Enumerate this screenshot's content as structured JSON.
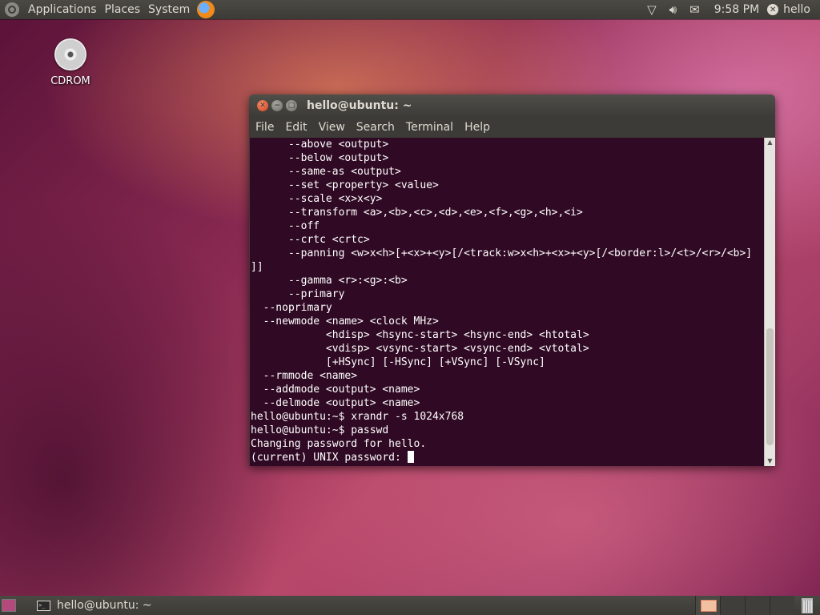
{
  "top_panel": {
    "menus": [
      "Applications",
      "Places",
      "System"
    ],
    "clock": "9:58 PM",
    "user": "hello"
  },
  "desktop": {
    "icons": [
      {
        "label": "CDROM",
        "icon": "cdrom-icon"
      }
    ]
  },
  "terminal_window": {
    "title": "hello@ubuntu: ~",
    "menus": [
      "File",
      "Edit",
      "View",
      "Search",
      "Terminal",
      "Help"
    ],
    "lines": [
      "      --above <output>",
      "      --below <output>",
      "      --same-as <output>",
      "      --set <property> <value>",
      "      --scale <x>x<y>",
      "      --transform <a>,<b>,<c>,<d>,<e>,<f>,<g>,<h>,<i>",
      "      --off",
      "      --crtc <crtc>",
      "      --panning <w>x<h>[+<x>+<y>[/<track:w>x<h>+<x>+<y>[/<border:l>/<t>/<r>/<b>]",
      "]]",
      "      --gamma <r>:<g>:<b>",
      "      --primary",
      "  --noprimary",
      "  --newmode <name> <clock MHz>",
      "            <hdisp> <hsync-start> <hsync-end> <htotal>",
      "            <vdisp> <vsync-start> <vsync-end> <vtotal>",
      "            [+HSync] [-HSync] [+VSync] [-VSync]",
      "  --rmmode <name>",
      "  --addmode <output> <name>",
      "  --delmode <output> <name>",
      "hello@ubuntu:~$ xrandr -s 1024x768",
      "hello@ubuntu:~$ passwd",
      "Changing password for hello."
    ],
    "prompt_line": "(current) UNIX password: "
  },
  "bottom_panel": {
    "taskbar_item": "hello@ubuntu: ~"
  }
}
